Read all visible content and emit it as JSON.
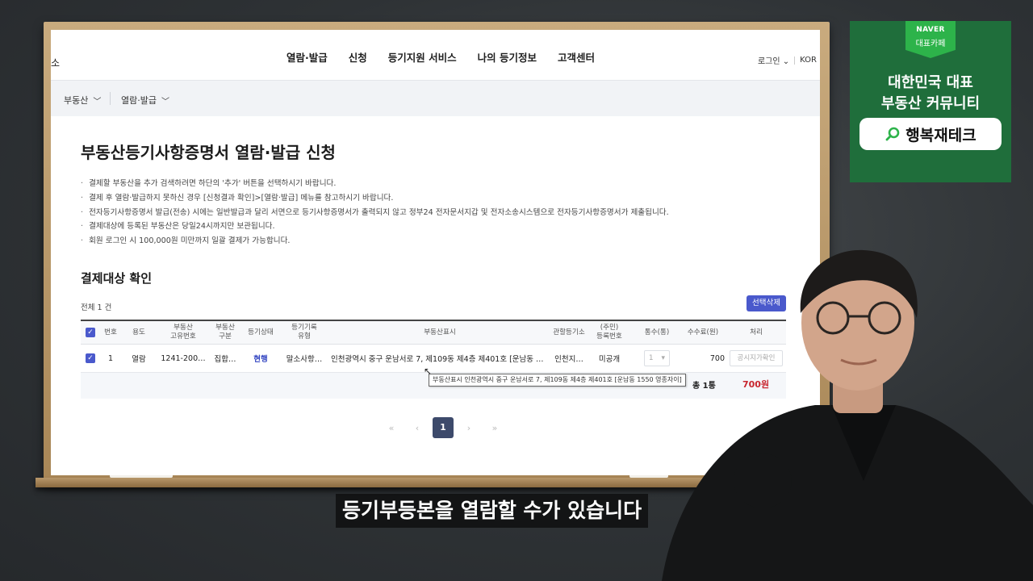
{
  "nav": {
    "left_fragment": "소",
    "menu": [
      "열람·발급",
      "신청",
      "등기지원 서비스",
      "나의 등기정보",
      "고객센터"
    ],
    "login": "로그인",
    "lang": "KOR"
  },
  "subbar": {
    "crumb1": "부동산",
    "crumb2": "열람·발급"
  },
  "page": {
    "title": "부동산등기사항증명서 열람·발급 신청",
    "notices": [
      "결제할 부동산을 추가 검색하려면 하단의 '추가' 버튼을 선택하시기 바랍니다.",
      "결제 후 열람·발급하지 못하신 경우 [신청결과 확인]>[열람·발급] 메뉴를 참고하시기 바랍니다.",
      "전자등기사항증명서 발급(전송) 시에는 일반발급과 달리 서면으로 등기사항증명서가 출력되지 않고 정부24 전자문서지갑 및 전자소송시스템으로 전자등기사항증명서가 제출됩니다.",
      "결제대상에 등록된 부동산은 당일24시까지만 보관됩니다.",
      "회원 로그인 시 100,000원 미만까지 일괄 결제가 가능합니다."
    ]
  },
  "payment": {
    "section_title": "결제대상 확인",
    "total_count": "전체 1 건",
    "delete_button": "선택삭제",
    "headers": {
      "no": "번호",
      "usage": "용도",
      "unique_no_1": "부동산",
      "unique_no_2": "고유번호",
      "type_1": "부동산",
      "type_2": "구분",
      "status": "등기상태",
      "record_type_1": "등기기록",
      "record_type_2": "유형",
      "address": "부동산표시",
      "office": "관할등기소",
      "reg_no_1": "(주민)",
      "reg_no_2": "등록번호",
      "qty": "통수(통)",
      "fee": "수수료(원)",
      "action": "처리"
    },
    "row": {
      "no": "1",
      "usage": "열람",
      "unique_no": "1241-200…",
      "type": "집합…",
      "status": "현행",
      "record_type": "말소사항…",
      "address": "인천광역시 중구 운남서로 7, 제109동 제4층 제401호 [운남동 …",
      "office": "인천지…",
      "reg_no": "미공개",
      "qty": "1",
      "fee": "700",
      "action": "공시지가확인"
    },
    "tooltip": "부동산표시 인천광역시 중구 운남서로 7, 제109동 제4층 제401호 [운남동 1550 영종자이]",
    "summary_count": "총 1통",
    "summary_fee": "700원"
  },
  "pager": {
    "first": "«",
    "prev": "‹",
    "current": "1",
    "next": "›",
    "last": "»"
  },
  "badge": {
    "naver": "NAVER",
    "cafe": "대표카페",
    "line1": "대한민국 대표",
    "line2": "부동산 커뮤니티",
    "search_text": "행복재테크"
  },
  "caption": "등기부등본을 열람할 수가 있습니다",
  "colors": {
    "accent": "#4a59cc",
    "badge_green": "#1f6e3b",
    "price_red": "#c8262e"
  }
}
